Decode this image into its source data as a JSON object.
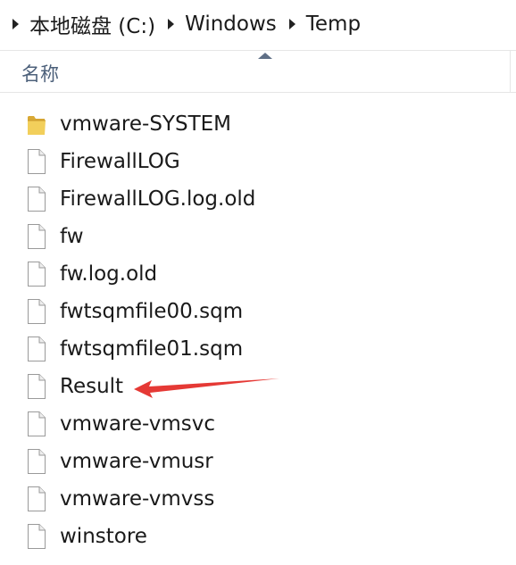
{
  "breadcrumb": {
    "items": [
      "本地磁盘 (C:)",
      "Windows",
      "Temp"
    ]
  },
  "column_header": {
    "name_label": "名称"
  },
  "files": [
    {
      "name": "vmware-SYSTEM",
      "type": "folder"
    },
    {
      "name": "FirewallLOG",
      "type": "file"
    },
    {
      "name": "FirewallLOG.log.old",
      "type": "file"
    },
    {
      "name": "fw",
      "type": "file"
    },
    {
      "name": "fw.log.old",
      "type": "file"
    },
    {
      "name": "fwtsqmfile00.sqm",
      "type": "file"
    },
    {
      "name": "fwtsqmfile01.sqm",
      "type": "file"
    },
    {
      "name": "Result",
      "type": "file"
    },
    {
      "name": "vmware-vmsvc",
      "type": "file"
    },
    {
      "name": "vmware-vmusr",
      "type": "file"
    },
    {
      "name": "vmware-vmvss",
      "type": "file"
    },
    {
      "name": "winstore",
      "type": "file"
    }
  ],
  "annotation": {
    "color": "#e53935",
    "points_to": "Result"
  },
  "colors": {
    "header_text": "#4c607a",
    "folder_yellow": "#e8c04a"
  }
}
